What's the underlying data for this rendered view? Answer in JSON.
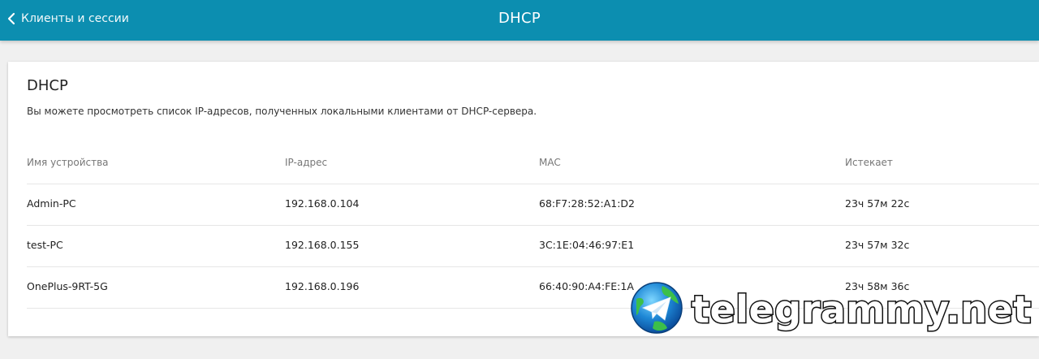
{
  "header": {
    "back_label": "Клиенты и сессии",
    "title": "DHCP"
  },
  "card": {
    "title": "DHCP",
    "description": "Вы можете просмотреть список IP-адресов, полученных локальными клиентами от DHCP-сервера."
  },
  "table": {
    "columns": [
      "Имя устройства",
      "IP-адрес",
      "MAC",
      "Истекает"
    ],
    "rows": [
      [
        "Admin-PC",
        "192.168.0.104",
        "68:F7:28:52:A1:D2",
        "23ч 57м 22с"
      ],
      [
        "test-PC",
        "192.168.0.155",
        "3C:1E:04:46:97:E1",
        "23ч 57м 32с"
      ],
      [
        "OnePlus-9RT-5G",
        "192.168.0.196",
        "66:40:90:A4:FE:1A",
        "23ч 58м 36с"
      ]
    ]
  },
  "watermark": {
    "text": "telegrammy.net",
    "icon": "telegram-globe-icon"
  },
  "colors": {
    "header_bg": "#0c8eb0",
    "page_bg": "#f0f0f0",
    "card_bg": "#ffffff"
  }
}
